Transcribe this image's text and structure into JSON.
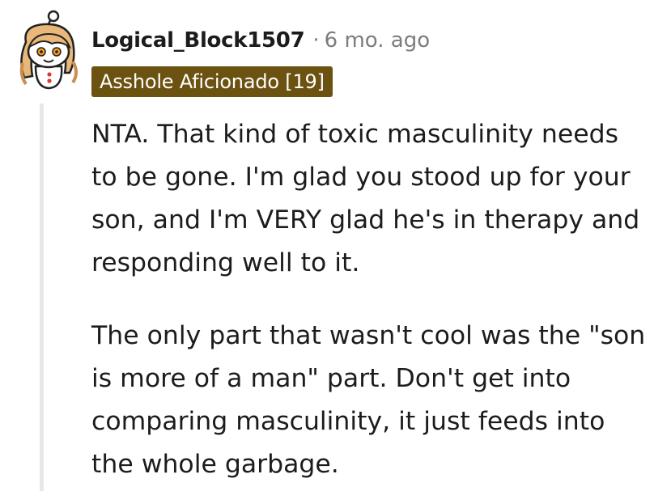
{
  "comment": {
    "author": "Logical_Block1507",
    "separator": "·",
    "timestamp": "6 mo. ago",
    "flair": "Asshole Aficionado [19]",
    "flair_color": "#6b5210",
    "avatar_icon": "snoo-avatar-icon",
    "paragraphs": [
      "NTA. That kind of toxic masculinity needs to be gone. I'm glad you stood up for your son, and I'm VERY glad he's in therapy and responding well to it.",
      "The only part that wasn't cool was the \"son is more of a man\" part. Don't get into comparing masculinity, it just feeds into the whole garbage."
    ]
  }
}
